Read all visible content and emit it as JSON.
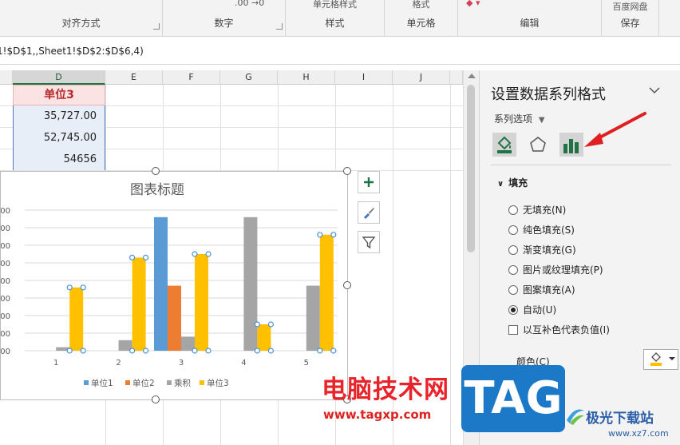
{
  "ribbon": {
    "groups": [
      "对齐方式",
      "数字",
      "样式",
      "单元格",
      "编辑",
      "保存"
    ],
    "styles_top": "单元格样式",
    "cells_top": "格式",
    "save_top": "百度网盘"
  },
  "formula_bar": {
    "text": "1!$D$1,,Sheet1!$D$2:$D$6,4)"
  },
  "sheet": {
    "columns": [
      "D",
      "E",
      "F",
      "G",
      "H",
      "I",
      "J"
    ],
    "header_cell": "单位3",
    "values": [
      "35,727.00",
      "52,745.00",
      "54656"
    ]
  },
  "chart_data": {
    "type": "bar",
    "title": "图表标题",
    "categories": [
      "1",
      "2",
      "3",
      "4",
      "5"
    ],
    "yticks": [
      "000",
      "000",
      "000",
      "000",
      "000",
      "000",
      "000",
      "000",
      "000"
    ],
    "ylim": [
      0,
      8
    ],
    "series": [
      {
        "name": "单位1",
        "color": "#5b9bd5",
        "values": [
          0,
          0,
          7.6,
          0,
          0
        ]
      },
      {
        "name": "单位2",
        "color": "#ed7d31",
        "values": [
          0,
          0,
          3.7,
          0,
          0
        ]
      },
      {
        "name": "乘积",
        "color": "#a5a5a5",
        "values": [
          0.2,
          0.6,
          0.8,
          7.6,
          3.7
        ]
      },
      {
        "name": "单位3",
        "color": "#ffc000",
        "values": [
          3.6,
          5.3,
          5.5,
          1.5,
          6.6
        ]
      }
    ],
    "legend": "bottom"
  },
  "pane": {
    "title": "设置数据系列格式",
    "series_options": "系列选项",
    "section": "填充",
    "options": [
      "无填充(N)",
      "纯色填充(S)",
      "渐变填充(G)",
      "图片或纹理填充(P)",
      "图案填充(A)",
      "自动(U)"
    ],
    "checkbox": "以互补色代表负值(I)",
    "color_label": "颜色(C)"
  },
  "watermark": {
    "site_cn": "电脑技术网",
    "site_url": "www.tagxp.com",
    "tag": "TAG",
    "brand2": "极光下载站",
    "brand2_url": "www.xz7.com"
  },
  "colors": {
    "accent": "#217346",
    "arrow": "#e02020"
  }
}
